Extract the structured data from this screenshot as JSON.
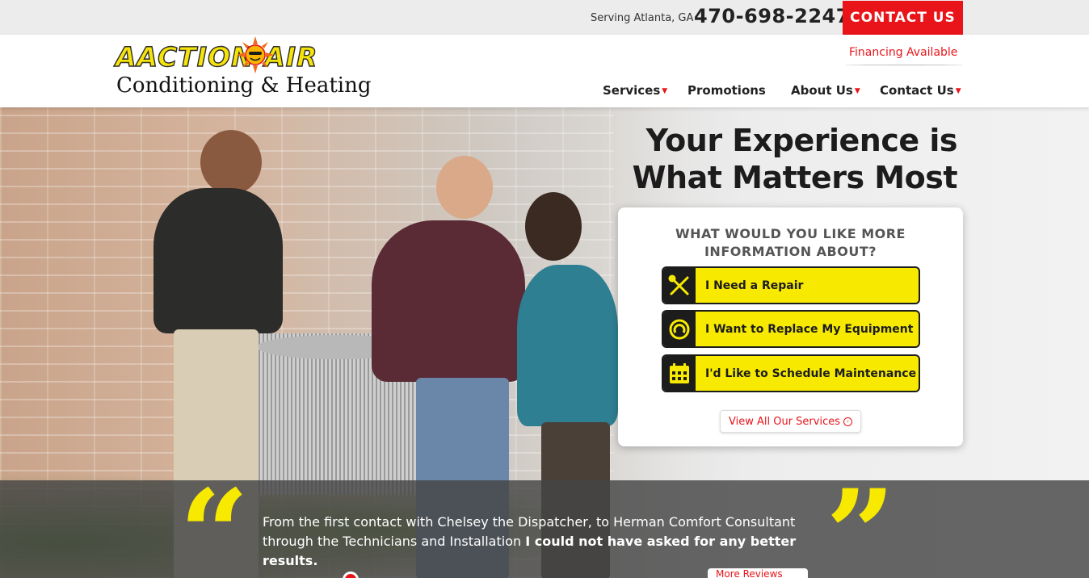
{
  "topbar": {
    "serving": "Serving Atlanta, GA",
    "phone": "470-698-2247",
    "contact_button": "CONTACT US"
  },
  "header": {
    "logo_line1": "AACTION AIR",
    "logo_line2": "Conditioning & Heating",
    "financing": "Financing Available",
    "nav": [
      {
        "label": "Services",
        "has_dropdown": true
      },
      {
        "label": "Promotions",
        "has_dropdown": false
      },
      {
        "label": "About Us",
        "has_dropdown": true
      },
      {
        "label": "Contact Us",
        "has_dropdown": true
      }
    ]
  },
  "hero": {
    "headline_line1": "Your Experience is",
    "headline_line2": "What Matters Most",
    "card": {
      "title_line1": "WHAT WOULD YOU LIKE MORE",
      "title_line2": "INFORMATION ABOUT?",
      "options": [
        {
          "label": "I Need a Repair",
          "icon": "wrench-screwdriver-icon"
        },
        {
          "label": "I Want to Replace My Equipment",
          "icon": "replace-cycle-icon"
        },
        {
          "label": "I'd Like to Schedule Maintenance",
          "icon": "calendar-icon"
        }
      ],
      "view_all": "View All Our Services"
    }
  },
  "testimonial": {
    "text_normal": "From the first contact with Chelsey the Dispatcher, to Herman Comfort Consultant through the Technicians and Installation ",
    "text_bold": "I could not have asked for any better results.",
    "more_reviews": "More Reviews"
  },
  "colors": {
    "brand_red": "#e8141a",
    "brand_yellow": "#f7ea00",
    "dark": "#1c1c1c"
  }
}
